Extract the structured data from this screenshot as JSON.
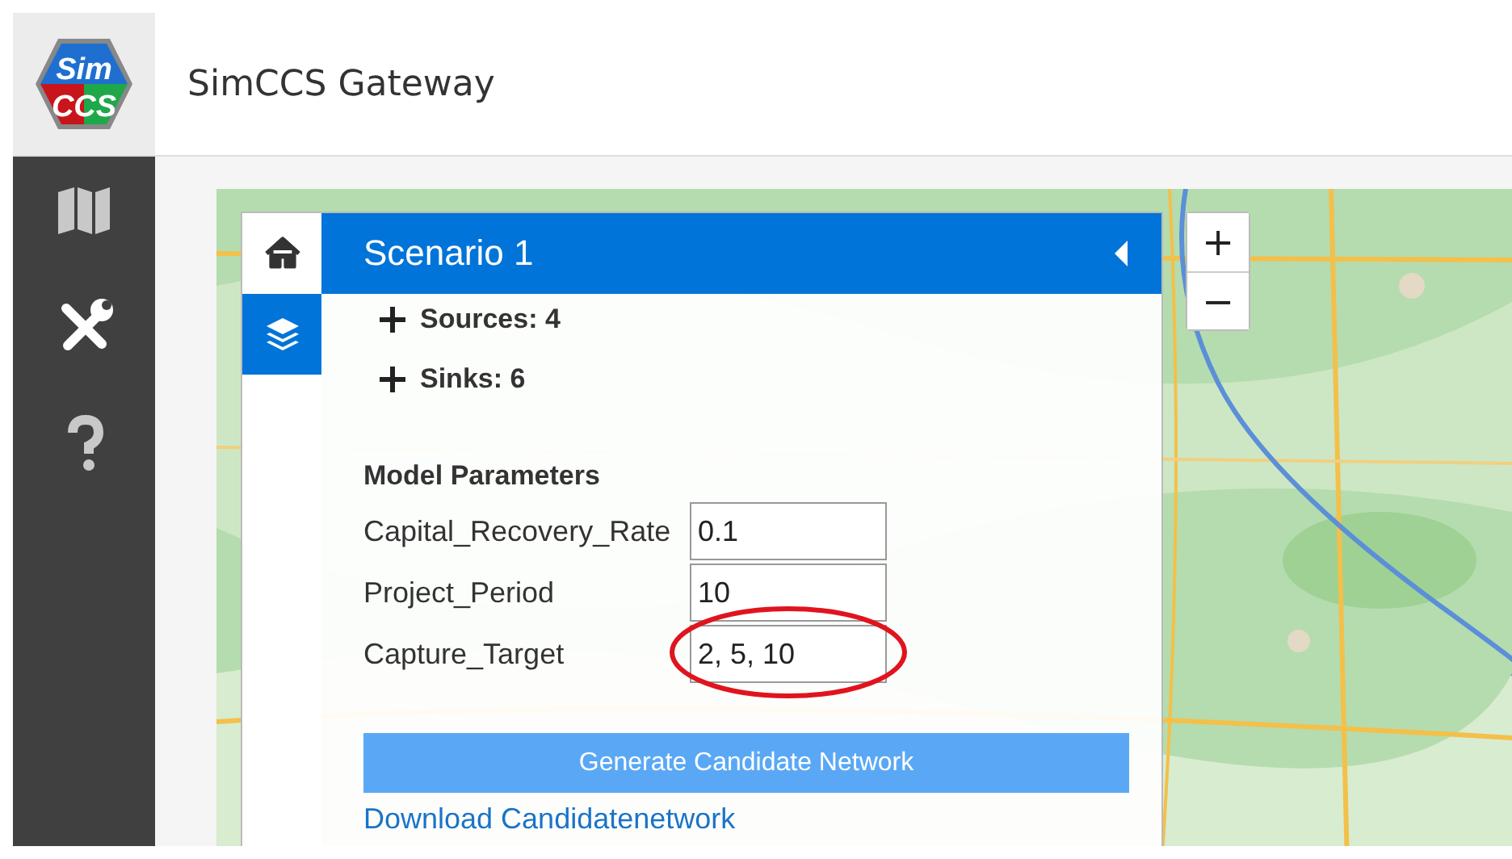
{
  "app": {
    "logo_lines": [
      "Sim",
      "CCS"
    ],
    "title": "SimCCS Gateway"
  },
  "nav": [
    {
      "kind": "map",
      "selected": false
    },
    {
      "kind": "tools",
      "selected": false
    },
    {
      "kind": "help",
      "selected": false
    }
  ],
  "map": {
    "kind": "picture",
    "zoom_controls": [
      "+",
      "−"
    ]
  },
  "panel": {
    "tabs": [
      {
        "kind": "home",
        "selected": false
      },
      {
        "kind": "layers",
        "selected": true
      }
    ],
    "title": "Scenario 1",
    "groups": [
      {
        "label": "Sources: 4",
        "expanded": false
      },
      {
        "label": "Sinks: 6",
        "expanded": false
      }
    ],
    "parameters_heading": "Model Parameters",
    "parameters": [
      {
        "name": "Capital_Recovery_Rate",
        "value": "0.1",
        "highlighted": false
      },
      {
        "name": "Project_Period",
        "value": "10",
        "highlighted": false
      },
      {
        "name": "Capture_Target",
        "value": "2, 5, 10",
        "highlighted": true
      }
    ],
    "generate_button": "Generate Candidate Network",
    "download_link": "Download Candidatenetwork"
  }
}
